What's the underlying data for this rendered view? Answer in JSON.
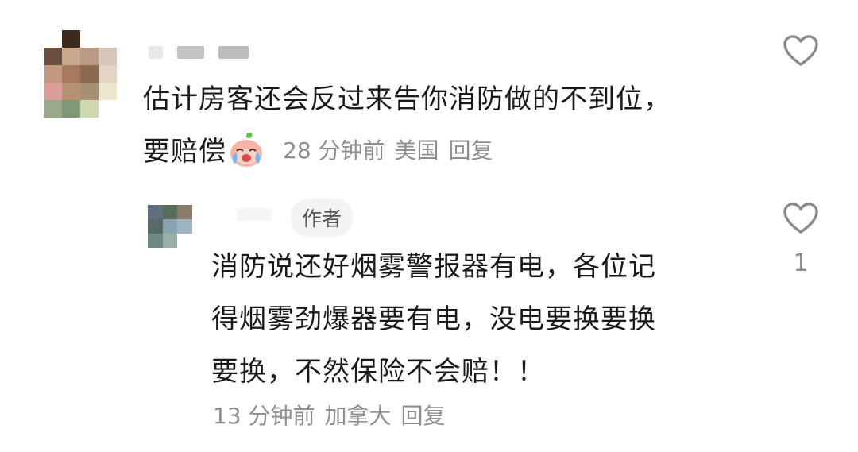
{
  "comments": [
    {
      "text_line1": "估计房客还会反过来告你消防做的不到位，",
      "text_line2": "要赔偿",
      "emoji": "crying-emoji",
      "time": "28 分钟前",
      "location": "美国",
      "reply_label": "回复",
      "like_icon": "heart-outline-icon"
    },
    {
      "badge": "作者",
      "text_line1": "消防说还好烟雾警报器有电，各位记",
      "text_line2": "得烟雾劲爆器要有电，没电要换要换",
      "text_line3": "要换，不然保险不会赔！！",
      "time": "13 分钟前",
      "location": "加拿大",
      "reply_label": "回复",
      "like_icon": "heart-outline-icon",
      "like_count": "1"
    }
  ],
  "colors": {
    "text": "#1a1a1a",
    "meta": "#8e8e8e",
    "badge_bg": "#f3f3f3"
  }
}
